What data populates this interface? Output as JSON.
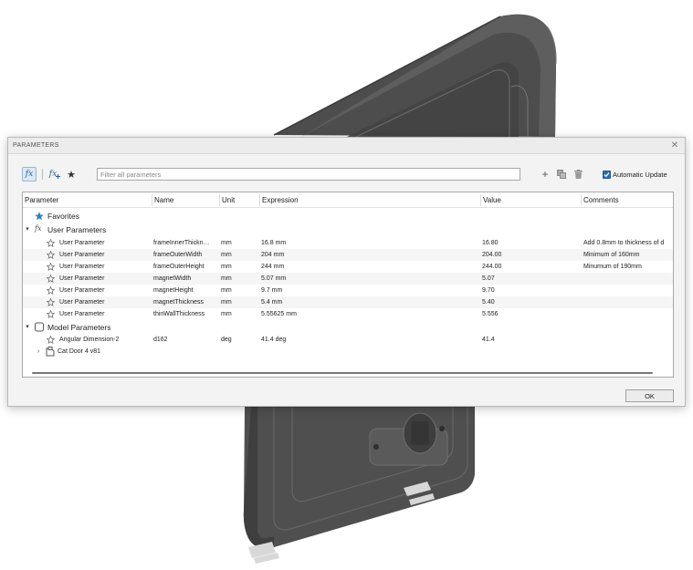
{
  "dialog": {
    "title": "PARAMETERS",
    "close_glyph": "✕",
    "toolbar": {
      "fx_label": "fx",
      "fx_add_label": "fx",
      "favorite_glyph": "★",
      "filter_placeholder": "Filter all parameters",
      "add_glyph": "+",
      "auto_update_label": "Automatic Update",
      "auto_update_checked": true
    },
    "columns": [
      "Parameter",
      "Name",
      "Unit",
      "Expression",
      "Value",
      "Comments"
    ],
    "groups": {
      "favorites": "Favorites",
      "user": "User Parameters",
      "model": "Model Parameters",
      "component": "Cat Door 4 v81"
    },
    "user_parameters": [
      {
        "parameter": "User Parameter",
        "name": "frameInnerThickn…",
        "unit": "mm",
        "expression": "16.8 mm",
        "value": "16.80",
        "comment": "Add 0.8mm to thickness of d"
      },
      {
        "parameter": "User Parameter",
        "name": "frameOuterWidth",
        "unit": "mm",
        "expression": "204 mm",
        "value": "204.00",
        "comment": "Minimum of 160mm"
      },
      {
        "parameter": "User Parameter",
        "name": "frameOuterHeight",
        "unit": "mm",
        "expression": "244 mm",
        "value": "244.00",
        "comment": "Minumum of 190mm"
      },
      {
        "parameter": "User Parameter",
        "name": "magnetWidth",
        "unit": "mm",
        "expression": "5.07 mm",
        "value": "5.07",
        "comment": ""
      },
      {
        "parameter": "User Parameter",
        "name": "magnetHeight",
        "unit": "mm",
        "expression": "9.7 mm",
        "value": "9.70",
        "comment": ""
      },
      {
        "parameter": "User Parameter",
        "name": "magnetThickness",
        "unit": "mm",
        "expression": "5.4 mm",
        "value": "5.40",
        "comment": ""
      },
      {
        "parameter": "User Parameter",
        "name": "thinWallThickness",
        "unit": "mm",
        "expression": "5.55625 mm",
        "value": "5.556",
        "comment": ""
      }
    ],
    "model_parameters": [
      {
        "parameter": "Angular Dimension-2",
        "name": "d162",
        "unit": "deg",
        "expression": "41.4 deg",
        "value": "41.4",
        "comment": ""
      }
    ],
    "ok_label": "OK"
  },
  "colors": {
    "accent": "#2a6db5",
    "model_dark": "#555555",
    "favorite_star": "#2f7ec2"
  },
  "icons": [
    "fx-icon",
    "fx-add-icon",
    "favorite-star-icon",
    "plus-icon",
    "copy-icon",
    "trash-icon",
    "star-outline-icon",
    "cube-icon",
    "component-icon",
    "chevron-down-icon",
    "chevron-right-icon",
    "close-icon",
    "checkmark-icon"
  ]
}
